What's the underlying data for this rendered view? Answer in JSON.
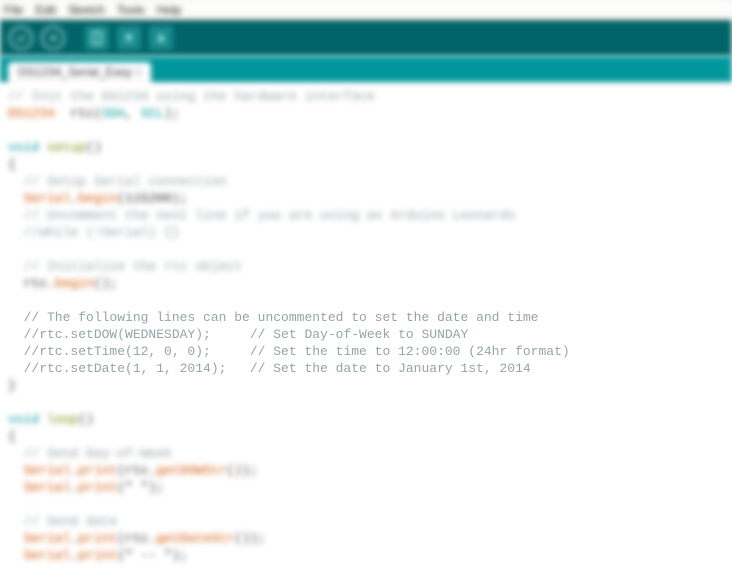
{
  "menu": {
    "file": "File",
    "edit": "Edit",
    "sketch": "Sketch",
    "tools": "Tools",
    "help": "Help"
  },
  "tab": {
    "name": "DS1234_Serial_Easy",
    "arrow": "§"
  },
  "code": {
    "c1": "// Init the DS1234 using the hardware interface",
    "inst_a": "DS1234",
    "inst_b": "  rtc(",
    "inst_c": "SDA",
    "inst_d": ", ",
    "inst_e": "SCL",
    "inst_f": ");",
    "setup_void": "void",
    "setup_name": " setup",
    "setup_par": "()",
    "brace_o": "{",
    "brace_c": "}",
    "c2": "  // Setup Serial connection",
    "s_begin_obj": "  Serial",
    "s_begin_dot": ".",
    "s_begin_fn": "begin",
    "s_begin_arg": "(115200);",
    "c3": "  // Uncomment the next line if you are using an Arduino Leonardo",
    "c4": "  //while (!Serial) {}",
    "c5": "  // Initialize the rtc object",
    "r_begin_a": "  rtc.",
    "r_begin_b": "begin",
    "r_begin_c": "();",
    "clear1": "  // The following lines can be uncommented to set the date and time",
    "clear2": "  //rtc.setDOW(WEDNESDAY);     // Set Day-of-Week to SUNDAY",
    "clear3": "  //rtc.setTime(12, 0, 0);     // Set the time to 12:00:00 (24hr format)",
    "clear4": "  //rtc.setDate(1, 1, 2014);   // Set the date to January 1st, 2014",
    "loop_void": "void",
    "loop_name": " loop",
    "loop_par": "()",
    "c6": "  // Send Day-of-Week",
    "p1a": "  Serial",
    "p1b": ".",
    "p1c": "print",
    "p1d": "(rtc.",
    "p1e": "getDOWStr",
    "p1f": "());",
    "p2a": "  Serial",
    "p2b": ".",
    "p2c": "print",
    "p2d": "(\" \");",
    "c7": "  // Send date",
    "p3a": "  Serial",
    "p3b": ".",
    "p3c": "print",
    "p3d": "(rtc.",
    "p3e": "getDateStr",
    "p3f": "());",
    "p4a": "  Serial",
    "p4b": ".",
    "p4c": "print",
    "p4d": "(\" -- \");"
  }
}
